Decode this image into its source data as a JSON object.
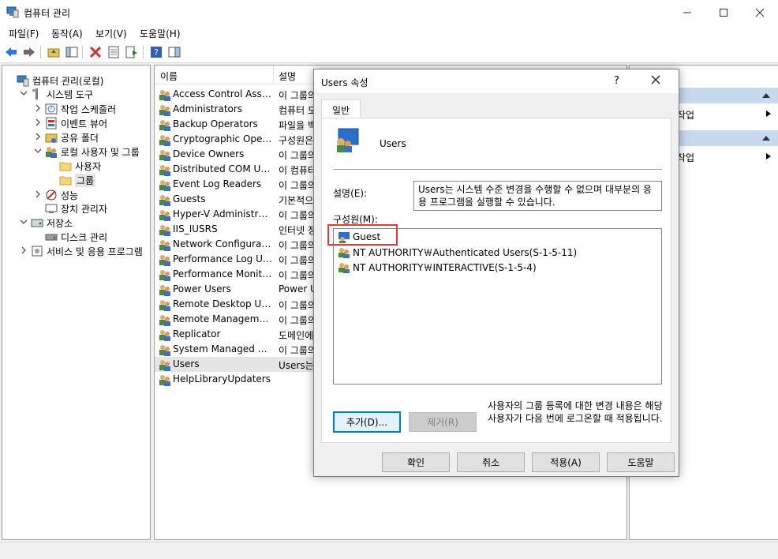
{
  "window": {
    "title": "컴퓨터 관리"
  },
  "menu": [
    "파일(F)",
    "동작(A)",
    "보기(V)",
    "도움말(H)"
  ],
  "tree": [
    {
      "label": "컴퓨터 관리(로컬)",
      "level": 0,
      "toggle": "",
      "icon": "computer-management-icon"
    },
    {
      "label": "시스템 도구",
      "level": 1,
      "toggle": "v",
      "icon": "tools-icon"
    },
    {
      "label": "작업 스케줄러",
      "level": 2,
      "toggle": ">",
      "icon": "task-scheduler-icon"
    },
    {
      "label": "이벤트 뷰어",
      "level": 2,
      "toggle": ">",
      "icon": "event-viewer-icon"
    },
    {
      "label": "공유 폴더",
      "level": 2,
      "toggle": ">",
      "icon": "shared-folder-icon"
    },
    {
      "label": "로컬 사용자 및 그룹",
      "level": 2,
      "toggle": "v",
      "icon": "users-groups-icon"
    },
    {
      "label": "사용자",
      "level": 3,
      "toggle": "",
      "icon": "folder-icon"
    },
    {
      "label": "그룹",
      "level": 3,
      "toggle": "",
      "icon": "folder-icon",
      "selected": true
    },
    {
      "label": "성능",
      "level": 2,
      "toggle": ">",
      "icon": "performance-icon"
    },
    {
      "label": "장치 관리자",
      "level": 2,
      "toggle": "",
      "icon": "device-manager-icon"
    },
    {
      "label": "저장소",
      "level": 1,
      "toggle": "v",
      "icon": "storage-icon"
    },
    {
      "label": "디스크 관리",
      "level": 2,
      "toggle": "",
      "icon": "disk-icon"
    },
    {
      "label": "서비스 및 응용 프로그램",
      "level": 1,
      "toggle": ">",
      "icon": "services-icon"
    }
  ],
  "list": {
    "columns": [
      "이름",
      "설명"
    ],
    "rows": [
      {
        "name": "Access Control Assist...",
        "desc": "이 그룹의"
      },
      {
        "name": "Administrators",
        "desc": "컴퓨터 도"
      },
      {
        "name": "Backup Operators",
        "desc": "파일을 백"
      },
      {
        "name": "Cryptographic Operat...",
        "desc": "구성원은"
      },
      {
        "name": "Device Owners",
        "desc": "이 그룹의"
      },
      {
        "name": "Distributed COM Users",
        "desc": "이 컴퓨터"
      },
      {
        "name": "Event Log Readers",
        "desc": "이 그룹의"
      },
      {
        "name": "Guests",
        "desc": "기본적으"
      },
      {
        "name": "Hyper-V Administrat...",
        "desc": "이 그룹의"
      },
      {
        "name": "IIS_IUSRS",
        "desc": "인터넷 정"
      },
      {
        "name": "Network Configuratio...",
        "desc": "이 그룹의"
      },
      {
        "name": "Performance Log Users",
        "desc": "이 그룹의"
      },
      {
        "name": "Performance Monitor...",
        "desc": "이 그룹의"
      },
      {
        "name": "Power Users",
        "desc": "Power U"
      },
      {
        "name": "Remote Desktop Users",
        "desc": "이 그룹의"
      },
      {
        "name": "Remote Management...",
        "desc": "이 그룹의"
      },
      {
        "name": "Replicator",
        "desc": "도메인에"
      },
      {
        "name": "System Managed Acc...",
        "desc": "이 그룹의"
      },
      {
        "name": "Users",
        "desc": "Users는",
        "selected": true
      },
      {
        "name": "HelpLibraryUpdaters",
        "desc": ""
      }
    ]
  },
  "actions": {
    "item1": "작업",
    "item2": "작업"
  },
  "dialog": {
    "title": "Users 속성",
    "help_glyph": "?",
    "tab": "일반",
    "group_name": "Users",
    "desc_label": "설명(E):",
    "desc_text": "Users는 시스템 수준 변경을 수행할 수 없으며 대부분의 응용 프로그램을 실행할 수 있습니다.",
    "members_label": "구성원(M):",
    "members": [
      "Guest",
      "NT AUTHORITY￦Authenticated Users(S-1-5-11)",
      "NT AUTHORITY￦INTERACTIVE(S-1-5-4)"
    ],
    "add_button": "추가(D)...",
    "remove_button": "제거(R)",
    "note": "사용자의 그룹 등록에 대한 변경 내용은 해당 사용자가 다음 번에 로그온할 때 적용됩니다.",
    "ok": "확인",
    "cancel": "취소",
    "apply": "적용(A)",
    "help": "도움말"
  },
  "colors": {
    "accent": "#0078d7",
    "highlight_box": "#e53935",
    "selected_row": "#e5e5e5"
  }
}
